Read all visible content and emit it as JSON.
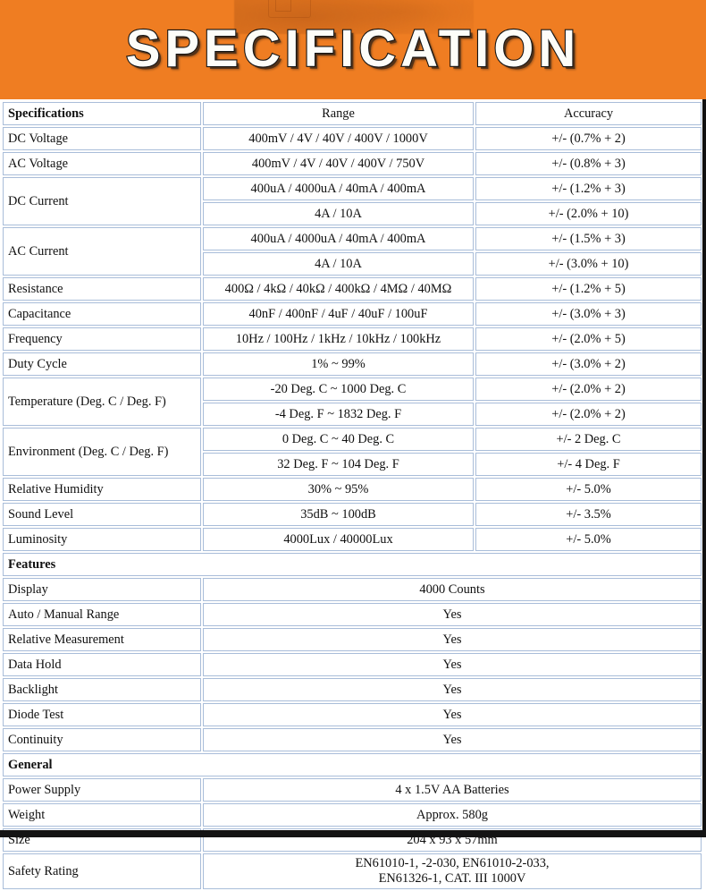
{
  "banner": {
    "title": "SPECIFICATION",
    "background_color": "#ef7d22",
    "title_color": "#fdfdf8",
    "title_outline_color": "#141414"
  },
  "table": {
    "accent_color": "#fbc108",
    "border_color": "#a9bdd9",
    "columns": [
      {
        "label": "Specifications"
      },
      {
        "label": "Range"
      },
      {
        "label": "Accuracy"
      }
    ],
    "measurement_rows": [
      {
        "name": "DC Voltage",
        "range": "400mV / 4V / 40V / 400V / 1000V",
        "accuracy": "+/- (0.7% + 2)"
      },
      {
        "name": "AC Voltage",
        "range": "400mV / 4V / 40V / 400V / 750V",
        "accuracy": "+/- (0.8% + 3)"
      },
      {
        "name": "DC Current",
        "range": "400uA / 4000uA / 40mA / 400mA",
        "accuracy": "+/- (1.2% + 3)",
        "range2": "4A / 10A",
        "accuracy2": "+/- (2.0% + 10)"
      },
      {
        "name": "AC Current",
        "range": "400uA / 4000uA / 40mA / 400mA",
        "accuracy": "+/- (1.5% + 3)",
        "range2": "4A / 10A",
        "accuracy2": "+/- (3.0% + 10)"
      },
      {
        "name": "Resistance",
        "range": "400Ω / 4kΩ / 40kΩ / 400kΩ / 4MΩ / 40MΩ",
        "accuracy": "+/- (1.2% + 5)"
      },
      {
        "name": "Capacitance",
        "range": "40nF / 400nF / 4uF / 40uF / 100uF",
        "accuracy": "+/- (3.0% + 3)"
      },
      {
        "name": "Frequency",
        "range": "10Hz / 100Hz / 1kHz / 10kHz / 100kHz",
        "accuracy": "+/- (2.0% + 5)"
      },
      {
        "name": "Duty Cycle",
        "range": "1% ~ 99%",
        "accuracy": "+/- (3.0% + 2)"
      },
      {
        "name": "Temperature (Deg. C / Deg. F)",
        "range": "-20 Deg. C ~ 1000 Deg. C",
        "accuracy": "+/- (2.0% + 2)",
        "range2": "-4 Deg. F ~ 1832 Deg. F",
        "accuracy2": "+/- (2.0% + 2)"
      },
      {
        "name": "Environment (Deg. C / Deg. F)",
        "range": "0 Deg. C ~ 40 Deg. C",
        "accuracy": "+/- 2 Deg. C",
        "range2": "32 Deg. F ~ 104 Deg. F",
        "accuracy2": "+/- 4 Deg. F"
      },
      {
        "name": "Relative Humidity",
        "range": "30% ~ 95%",
        "accuracy": "+/- 5.0%"
      },
      {
        "name": "Sound Level",
        "range": "35dB ~ 100dB",
        "accuracy": "+/- 3.5%"
      },
      {
        "name": "Luminosity",
        "range": "4000Lux / 40000Lux",
        "accuracy": "+/- 5.0%"
      }
    ],
    "features_section": {
      "title": "Features",
      "rows": [
        {
          "name": "Display",
          "value": "4000 Counts"
        },
        {
          "name": "Auto / Manual Range",
          "value": "Yes"
        },
        {
          "name": "Relative Measurement",
          "value": "Yes"
        },
        {
          "name": "Data Hold",
          "value": "Yes"
        },
        {
          "name": "Backlight",
          "value": "Yes"
        },
        {
          "name": "Diode Test",
          "value": "Yes"
        },
        {
          "name": "Continuity",
          "value": "Yes"
        }
      ]
    },
    "general_section": {
      "title": "General",
      "rows": [
        {
          "name": "Power Supply",
          "value": "4 x 1.5V AA Batteries"
        },
        {
          "name": "Weight",
          "value": "Approx. 580g"
        },
        {
          "name": "Size",
          "value": "204 x 93 x 57mm"
        },
        {
          "name": "Safety Rating",
          "value": "EN61010-1, -2-030, EN61010-2-033,",
          "value_line2": "EN61326-1, CAT. III 1000V"
        }
      ]
    }
  }
}
